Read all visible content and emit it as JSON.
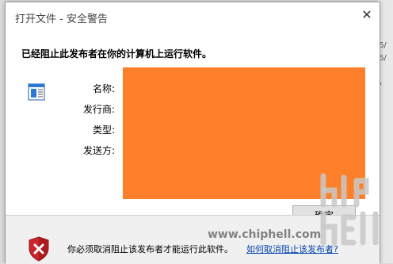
{
  "window": {
    "title": "打开文件 - 安全警告",
    "close_symbol": "✕"
  },
  "dialog": {
    "heading": "已经阻止此发布者在你的计算机上运行软件。",
    "fields": {
      "name_label": "名称:",
      "publisher_label": "发行商:",
      "type_label": "类型:",
      "from_label": "发送方:"
    },
    "redaction_color": "#fd7f2a",
    "run_button_label": "确定"
  },
  "footer": {
    "message": "你必须取消阻止该发布者才能运行此软件。",
    "help_link": "如何取消阻止该发布者?"
  },
  "background": {
    "fragments": [
      "6/",
      "\\",
      "6/"
    ]
  },
  "watermark": {
    "url_text": "www.chiphell.com",
    "logo_text": "chip hell"
  },
  "icons": {
    "app_icon": "application-window-icon",
    "shield_icon": "red-shield-x-icon"
  }
}
